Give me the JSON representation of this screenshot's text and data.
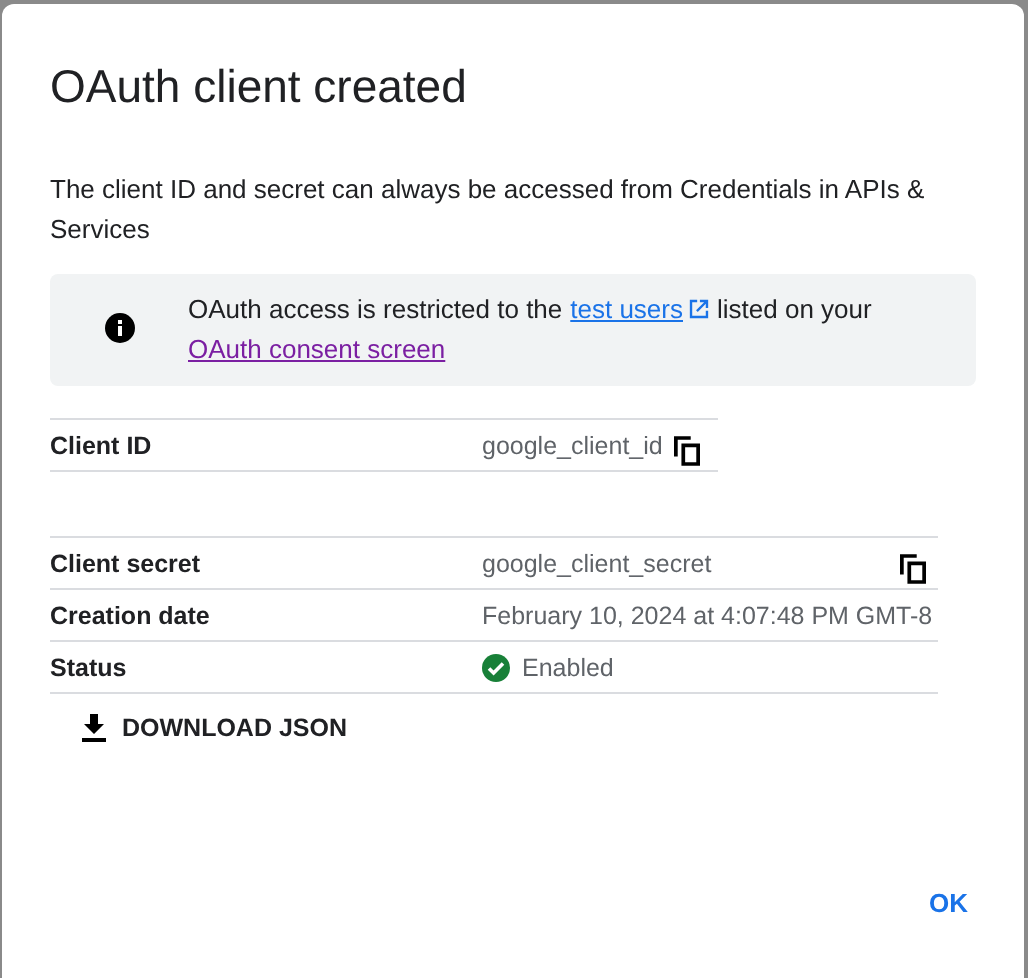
{
  "dialog": {
    "title": "OAuth client created",
    "description": "The client ID and secret can always be accessed from Credentials in APIs & Services",
    "notice": {
      "text_before": "OAuth access is restricted to the",
      "link_1": "test users",
      "text_middle": "listed on your",
      "link_2": "OAuth consent screen"
    },
    "id_table": [
      {
        "kind": "copy",
        "label": "Client ID",
        "value": "google_client_id"
      }
    ],
    "detail_table": [
      {
        "kind": "copy",
        "label": "Client secret",
        "value": "google_client_secret"
      },
      {
        "kind": "plain",
        "label": "Creation date",
        "value": "February 10, 2024 at 4:07:48 PM GMT-8"
      },
      {
        "kind": "status",
        "label": "Status",
        "value": "Enabled"
      }
    ],
    "download_button": "DOWNLOAD JSON",
    "ok_button": "OK"
  }
}
